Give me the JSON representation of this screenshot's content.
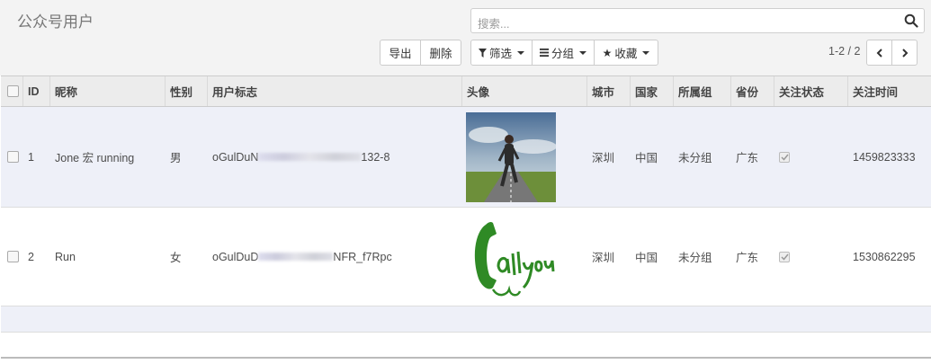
{
  "title": "公众号用户",
  "search": {
    "placeholder": "搜索..."
  },
  "toolbar": {
    "export": "导出",
    "delete": "删除"
  },
  "filters": {
    "filter": "筛选",
    "group": "分组",
    "favorites": "收藏"
  },
  "pager": {
    "value": "1-2 / 2"
  },
  "columns": [
    "ID",
    "昵称",
    "性别",
    "用户标志",
    "头像",
    "城市",
    "国家",
    "所属组",
    "省份",
    "关注状态",
    "关注时间"
  ],
  "rows": [
    {
      "id": "1",
      "nickname": "Jone 宏 running",
      "gender": "男",
      "openid": "oGulDuN",
      "openid_tail": "132-8",
      "city": "深圳",
      "country": "中国",
      "group": "未分组",
      "province": "广东",
      "subscribed": true,
      "subscribe_time": "1459823333"
    },
    {
      "id": "2",
      "nickname": "Run",
      "gender": "女",
      "openid": "oGulDuD",
      "openid_tail": "NFR_f7Rpc",
      "city": "深圳",
      "country": "中国",
      "group": "未分组",
      "province": "广东",
      "subscribed": true,
      "subscribe_time": "1530862295"
    }
  ],
  "colors": {
    "row_alt": "#eef0f8",
    "header_bg": "#ececec",
    "panel_bg": "#f3f3f3"
  }
}
